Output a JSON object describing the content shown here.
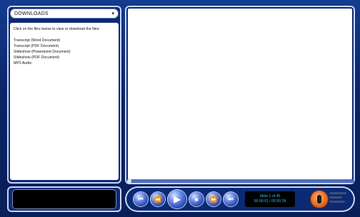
{
  "downloads": {
    "dropdown_label": "DOWNLOADS",
    "dropdown_chevron_icon": "chevron-down",
    "instructions": "Click on the files below to view or download the files:",
    "files": [
      "Transcript (Word Document)",
      "Transcript (PDF Document)",
      "Slideshow (Powerpoint Document)",
      "Slideshow (PDF Document)",
      "MP3 Audio"
    ]
  },
  "player": {
    "slide_status": "Slide 1 of 45",
    "time": "00:00:01 / 00:30:39",
    "controls": [
      "rewind",
      "previous",
      "play",
      "stop",
      "next",
      "fast-forward"
    ],
    "progress_fraction": 0.0
  },
  "colors": {
    "frame_blue": "#0b2a74",
    "accent_cyan": "#1cc8ff",
    "logo_orange": "#e06d26"
  }
}
